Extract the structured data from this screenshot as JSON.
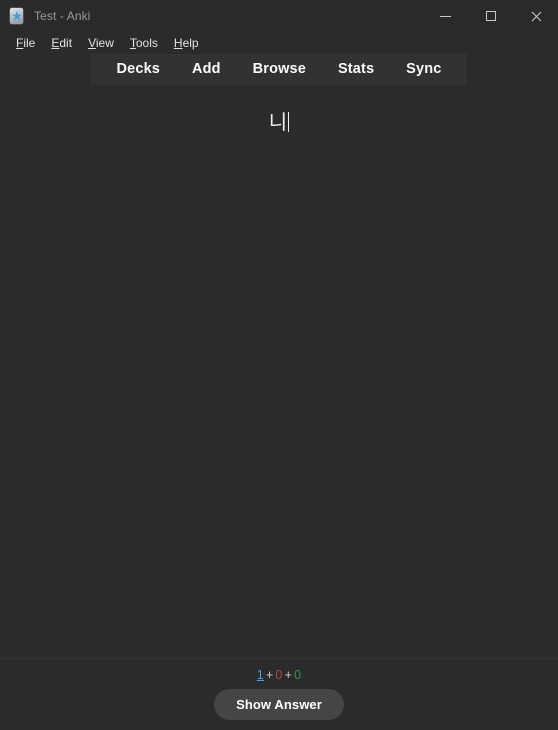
{
  "window": {
    "title": "Test - Anki",
    "icon": "anki-app-icon",
    "controls": {
      "minimize": "minimize-icon",
      "maximize": "maximize-icon",
      "close": "close-icon"
    }
  },
  "menubar": {
    "items": [
      {
        "label": "File",
        "accel": "F",
        "rest": "ile"
      },
      {
        "label": "Edit",
        "accel": "E",
        "rest": "dit"
      },
      {
        "label": "View",
        "accel": "V",
        "rest": "iew"
      },
      {
        "label": "Tools",
        "accel": "T",
        "rest": "ools"
      },
      {
        "label": "Help",
        "accel": "H",
        "rest": "elp"
      }
    ]
  },
  "navbar": {
    "items": [
      {
        "label": "Decks"
      },
      {
        "label": "Add"
      },
      {
        "label": "Browse"
      },
      {
        "label": "Stats"
      },
      {
        "label": "Sync"
      }
    ]
  },
  "reviewer": {
    "card_text": "니",
    "caret_visible": true
  },
  "bottombar": {
    "counts": {
      "new": "1",
      "learning": "0",
      "review": "0",
      "separator": "+"
    },
    "show_answer_label": "Show Answer"
  },
  "colors": {
    "window_bg": "#2b2b2b",
    "titlebar_bg": "#2a2a2a",
    "navbar_bg": "#323232",
    "button_bg": "#454545",
    "count_new": "#4a9eea",
    "count_learning": "#b34747",
    "count_review": "#2e9e4f",
    "text_primary": "#e8e8e8",
    "title_text": "#9a9a9a"
  }
}
